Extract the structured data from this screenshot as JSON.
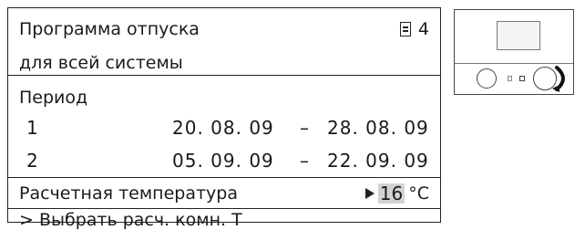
{
  "screen": {
    "title": "Программа отпуска",
    "subtitle": "для всей системы",
    "page_number": "4",
    "period_label": "Период",
    "periods": [
      {
        "num": "1",
        "start": "20. 08. 09",
        "sep": "–",
        "end": "28. 08. 09"
      },
      {
        "num": "2",
        "start": "05. 09. 09",
        "sep": "–",
        "end": "22. 09. 09"
      }
    ],
    "temperature_label": "Расчетная температура",
    "temperature_value": "16",
    "temperature_unit": "°C",
    "hint": "> Выбрать расч. комн. Т"
  },
  "device": {
    "icons": [
      "display-icon",
      "left-knob-icon",
      "right-knob-icon",
      "rotate-arrow-icon"
    ]
  }
}
